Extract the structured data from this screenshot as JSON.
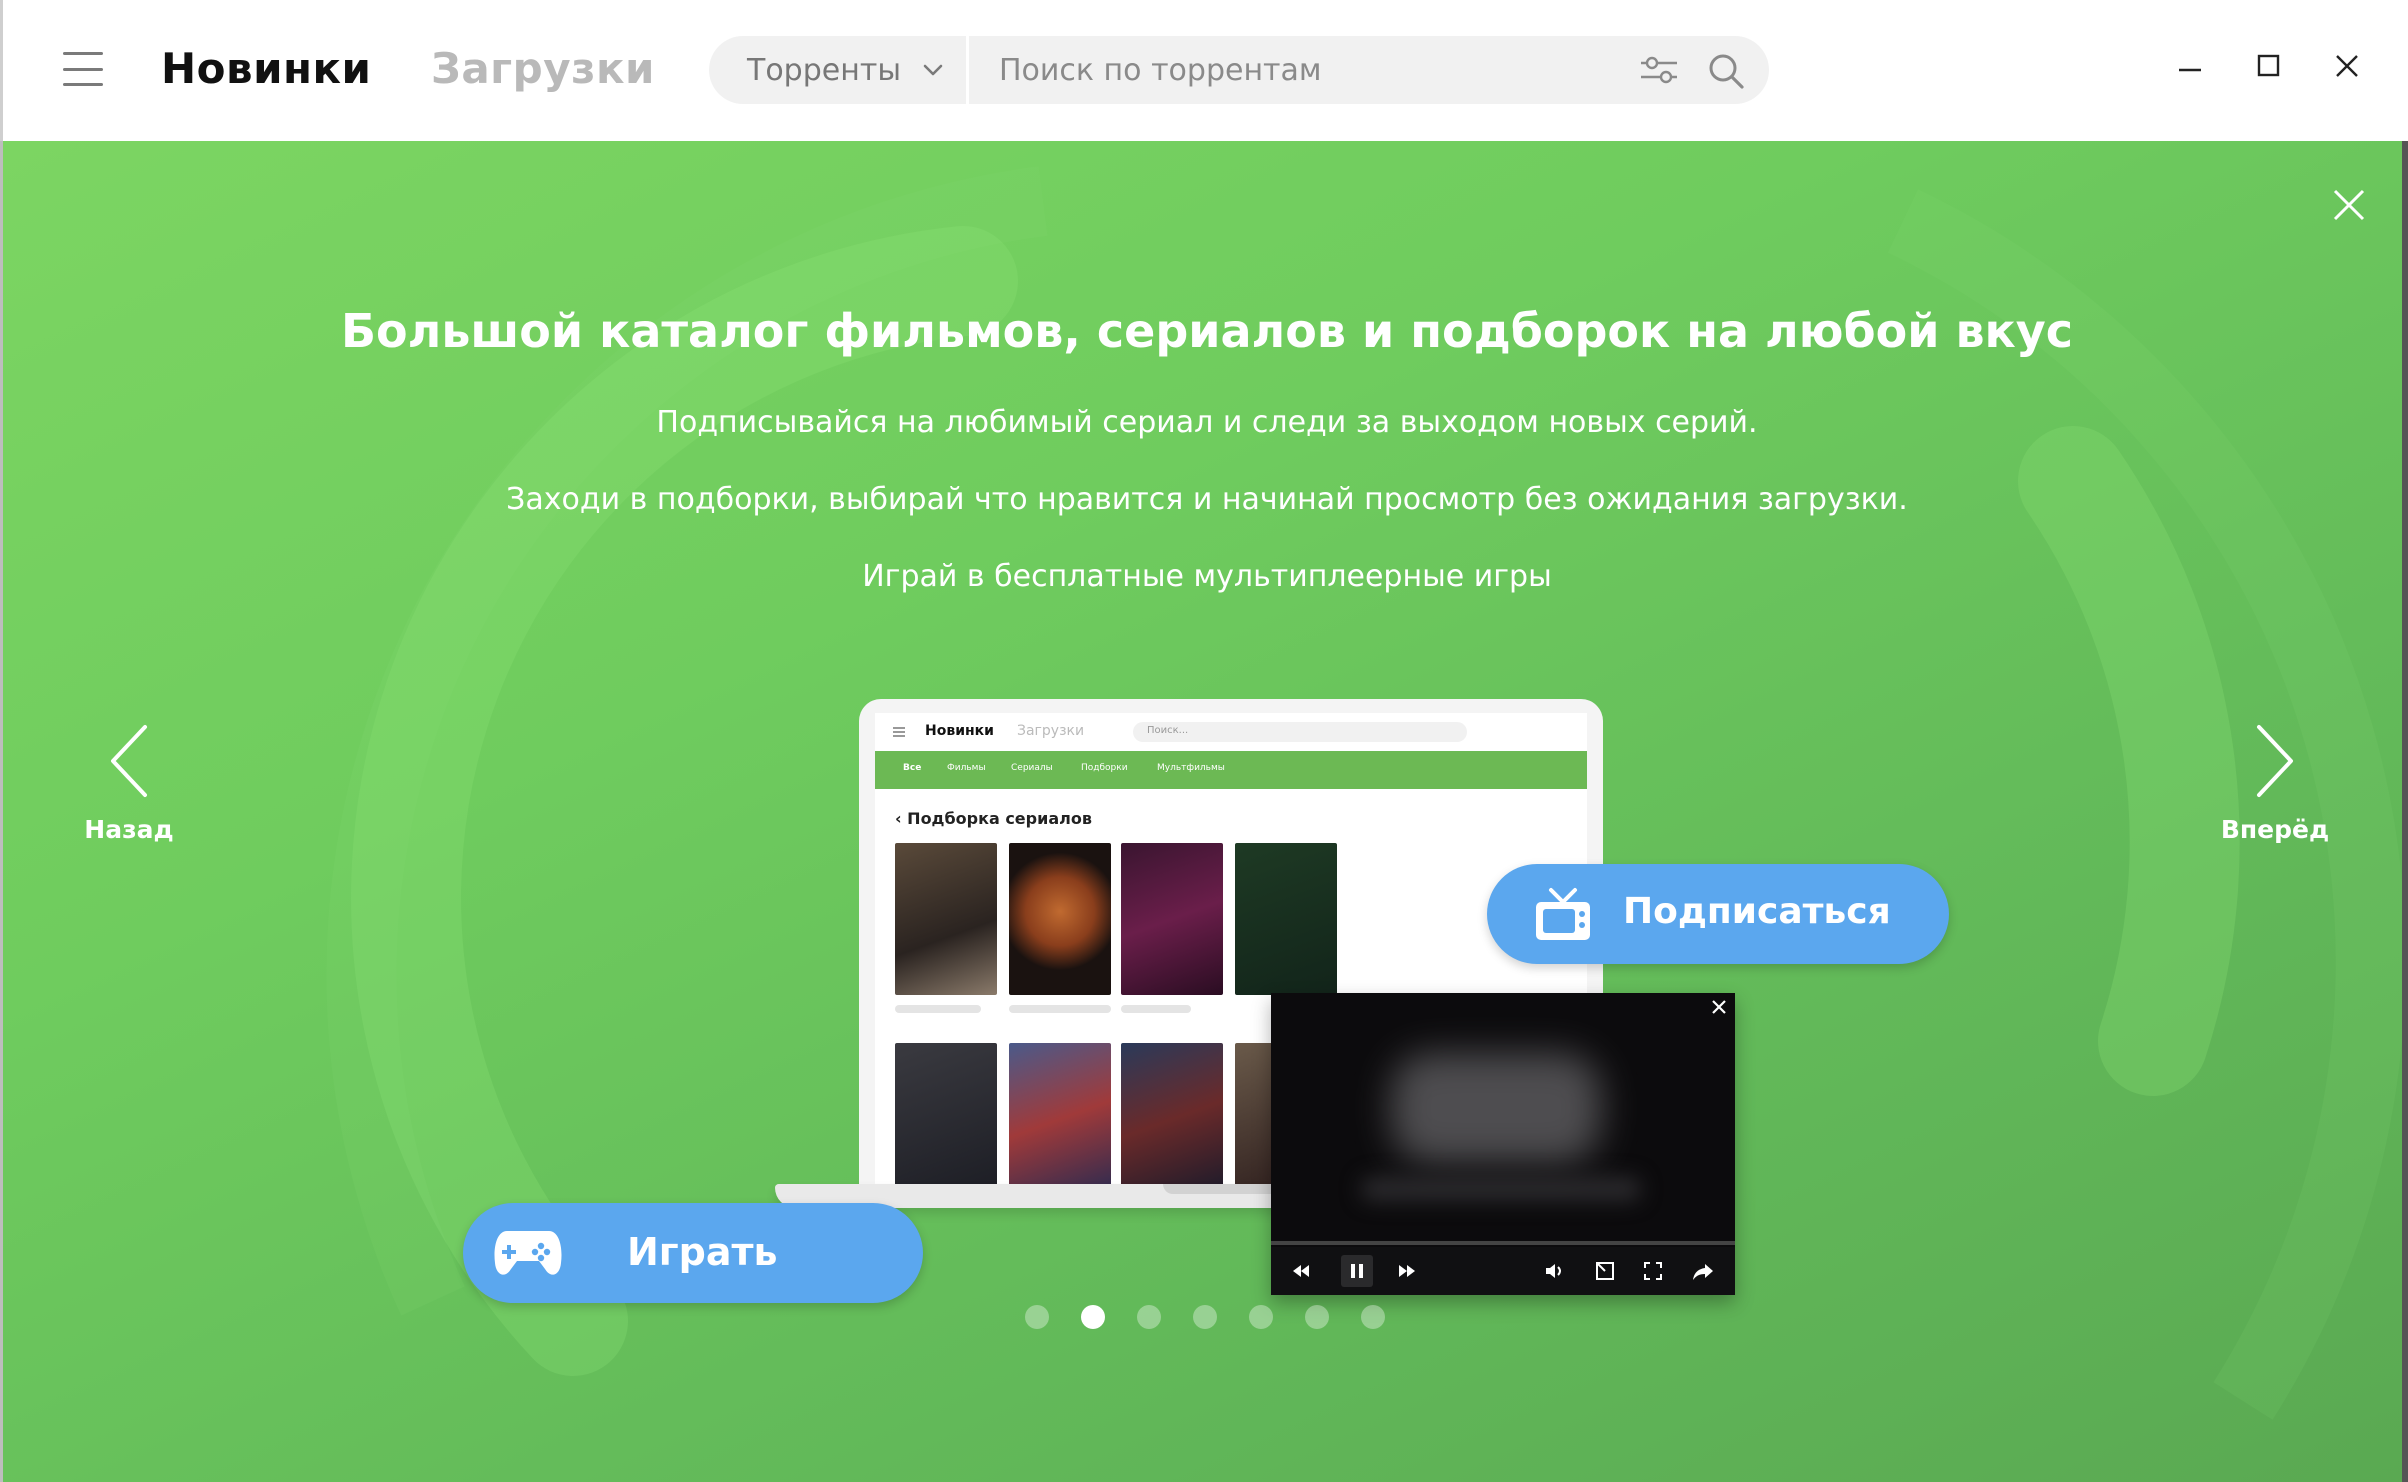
{
  "header": {
    "menu_icon": "hamburger-menu-icon",
    "tab_new": "Новинки",
    "tab_downloads": "Загрузки",
    "search": {
      "category": "Торренты",
      "placeholder": "Поиск по торрентам",
      "filter_icon": "filter-sliders-icon",
      "search_icon": "magnifier-icon"
    },
    "window_controls": [
      "minimize-icon",
      "maximize-icon",
      "close-icon"
    ]
  },
  "banner": {
    "colors": {
      "bg_start": "#7cd562",
      "bg_end": "#5aa952",
      "button": "#5ba7ee",
      "text": "#ffffff"
    },
    "title": "Большой каталог фильмов, сериалов и подборок на любой вкус",
    "lines": [
      "Подписывайся на любимый сериал и следи за выходом новых серий.",
      "Заходи в подборки, выбирай что нравится и начинай просмотр без ожидания загрузки.",
      "Играй в бесплатные мультиплеерные игры"
    ],
    "prev_label": "Назад",
    "next_label": "Вперёд",
    "subscribe_label": "Подписаться",
    "play_label": "Играть",
    "dots_total": 7,
    "dots_active": 2
  },
  "mockup": {
    "title": "Новинки",
    "downloads": "Загрузки",
    "search_placeholder": "Поиск...",
    "categories": [
      "Все",
      "Фильмы",
      "Сериалы",
      "Подборки",
      "Мультфильмы"
    ],
    "back_label": "Подборка сериалов"
  }
}
